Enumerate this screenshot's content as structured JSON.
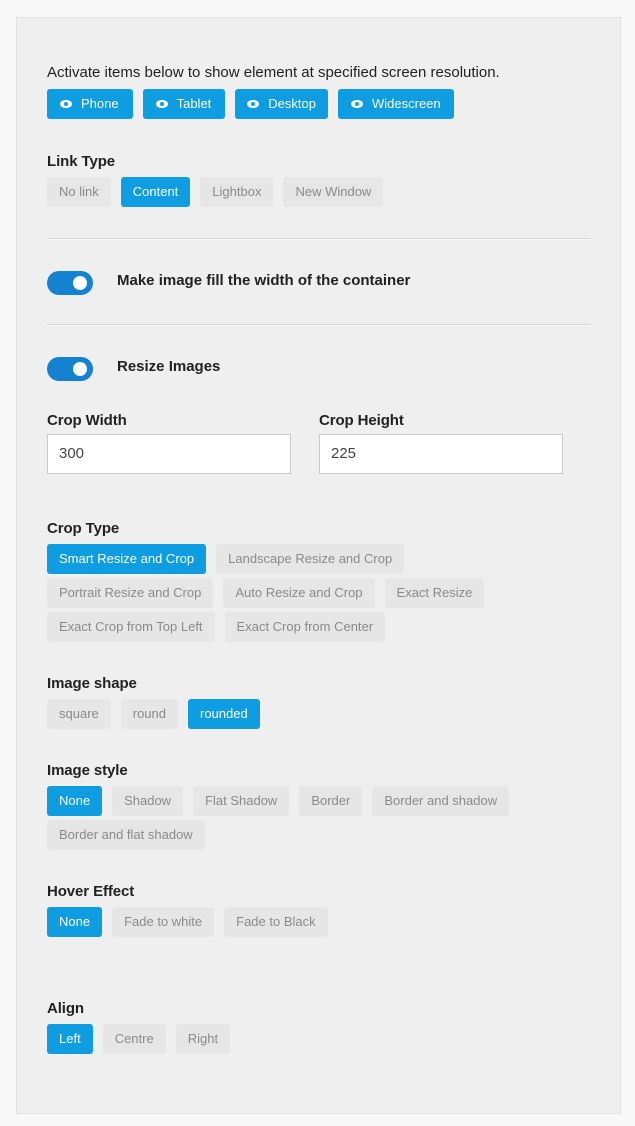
{
  "visibility": {
    "intro": "Activate items below to show element at specified screen resolution.",
    "devices": [
      {
        "label": "Phone",
        "icon": "eye-icon",
        "active": true
      },
      {
        "label": "Tablet",
        "icon": "eye-icon",
        "active": true
      },
      {
        "label": "Desktop",
        "icon": "eye-icon",
        "active": true
      },
      {
        "label": "Widescreen",
        "icon": "eye-icon",
        "active": true
      }
    ]
  },
  "link_type": {
    "label": "Link Type",
    "options": [
      "No link",
      "Content",
      "Lightbox",
      "New Window"
    ],
    "selected": "Content"
  },
  "fill_width": {
    "label": "Make image fill the width of the container",
    "on": true
  },
  "resize_images": {
    "label": "Resize Images",
    "on": true
  },
  "crop_width": {
    "label": "Crop Width",
    "value": "300"
  },
  "crop_height": {
    "label": "Crop Height",
    "value": "225"
  },
  "crop_type": {
    "label": "Crop Type",
    "options": [
      "Smart Resize and Crop",
      "Landscape Resize and Crop",
      "Portrait Resize and Crop",
      "Auto Resize and Crop",
      "Exact Resize",
      "Exact Crop from Top Left",
      "Exact Crop from Center"
    ],
    "selected": "Smart Resize and Crop"
  },
  "image_shape": {
    "label": "Image shape",
    "options": [
      "square",
      "round",
      "rounded"
    ],
    "selected": "rounded"
  },
  "image_style": {
    "label": "Image style",
    "options": [
      "None",
      "Shadow",
      "Flat Shadow",
      "Border",
      "Border and shadow",
      "Border and flat shadow"
    ],
    "selected": "None"
  },
  "hover_effect": {
    "label": "Hover Effect",
    "options": [
      "None",
      "Fade to white",
      "Fade to Black"
    ],
    "selected": "None"
  },
  "align": {
    "label": "Align",
    "options": [
      "Left",
      "Centre",
      "Right"
    ],
    "selected": "Left"
  },
  "colors": {
    "accent": "#0e9de0",
    "toggle": "#1482d0",
    "inactive_bg": "#e6e6e6",
    "inactive_text": "#8a8a8a"
  }
}
